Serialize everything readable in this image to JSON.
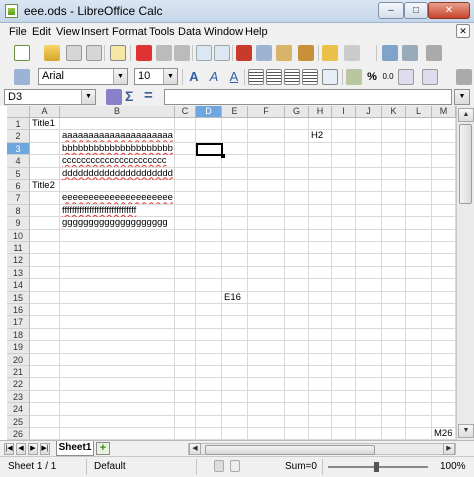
{
  "window": {
    "title": "eee.ods - LibreOffice Calc",
    "min_label": "–",
    "max_label": "□",
    "close_label": "✕"
  },
  "menu": [
    "File",
    "Edit",
    "View",
    "Insert",
    "Format",
    "Tools",
    "Data",
    "Window",
    "Help"
  ],
  "toolbar": {
    "font_name": "Arial",
    "font_size": "10"
  },
  "formula_bar": {
    "name_box": "D3",
    "formula": "",
    "sigma": "Σ",
    "equals": "="
  },
  "grid": {
    "columns": [
      "A",
      "B",
      "C",
      "D",
      "E",
      "F",
      "G",
      "H",
      "I",
      "J",
      "K",
      "L",
      "M"
    ],
    "selected_column": "D",
    "rows": [
      "1",
      "2",
      "3",
      "4",
      "5",
      "6",
      "7",
      "8",
      "9",
      "10",
      "11",
      "12",
      "13",
      "14",
      "15",
      "16",
      "17",
      "18",
      "19",
      "20",
      "21",
      "22",
      "23",
      "24",
      "25",
      "26"
    ],
    "selected_row": "3",
    "cells": {
      "A1": "Title1",
      "B2": "aaaaaaaaaaaaaaaaaaaaa",
      "B3": "bbbbbbbbbbbbbbbbbbbbb",
      "B4": "cccccccccccccccccccccc",
      "B5": "ddddddddddddddddddddd",
      "A6": "Title2",
      "B7": "eeeeeeeeeeeeeeeeeeeee",
      "B8": "ffffffffffffffffffffffffffffff",
      "B9": "gggggggggggggggggggg",
      "H2": "H2",
      "E15": "E16",
      "M26": "M26"
    }
  },
  "sheet_tabs": {
    "active": "Sheet1",
    "add_label": "+"
  },
  "status": {
    "sheet_pos": "Sheet 1 / 1",
    "style": "Default",
    "sum": "Sum=0",
    "zoom": "100%"
  }
}
